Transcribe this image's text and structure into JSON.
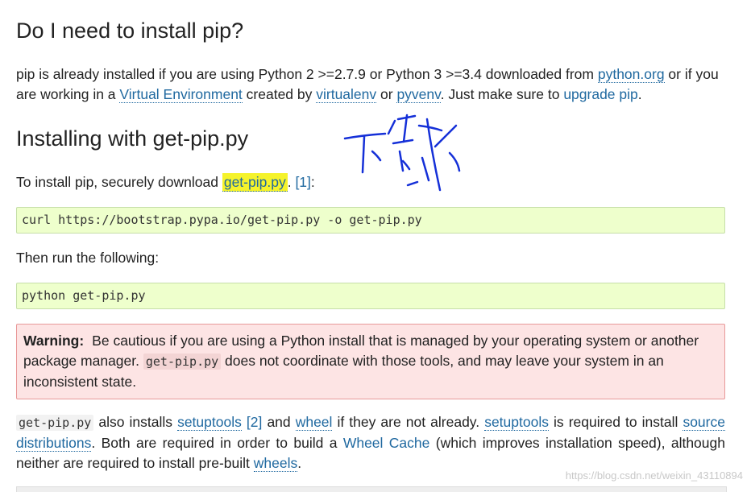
{
  "section_install": {
    "heading": "Do I need to install pip?",
    "text_1": "pip is already installed if you are using Python 2 >=2.7.9 or Python 3 >=3.4 downloaded from ",
    "link_python_org": "python.org",
    "text_2": " or if you are working in a ",
    "link_virtual_env": "Virtual Environment",
    "text_3": " created by ",
    "link_virtualenv": "virtualenv",
    "text_4": " or ",
    "link_pyvenv": "pyvenv",
    "text_5": ". Just make sure to ",
    "link_upgrade_pip": "upgrade pip",
    "text_6": "."
  },
  "section_get_pip": {
    "heading": "Installing with get-pip.py",
    "text_1": "To install pip, securely download ",
    "link_get_pip": "get-pip.py",
    "text_2": ". ",
    "link_footnote": "[1]",
    "text_3": ":",
    "code_curl": "curl https://bootstrap.pypa.io/get-pip.py -o get-pip.py",
    "then_text": "Then run the following:",
    "code_python": "python get-pip.py"
  },
  "warning": {
    "label": "Warning:",
    "text_1": "Be cautious if you are using a Python install that is managed by your operating system or another package manager. ",
    "code": "get-pip.py",
    "text_2": " does not coordinate with those tools, and may leave your system in an inconsistent state."
  },
  "setup_para": {
    "code": "get-pip.py",
    "text_1": " also installs ",
    "link_setuptools": "setuptools",
    "text_sp1": " ",
    "link_footnote2": "[2]",
    "text_2": " and ",
    "link_wheel": "wheel",
    "text_3": " if they are not already. ",
    "link_setuptools2": "setuptools",
    "text_4": " is required to install ",
    "link_source_dist": "source distributions",
    "text_5": ". Both are required in order to build a ",
    "link_wheel_cache": "Wheel Cache",
    "text_6": " (which improves installation speed), although neither are required to install pre-built ",
    "link_wheels": "wheels",
    "text_7": "."
  },
  "watermark": "https://blog.csdn.net/weixin_43110894",
  "colors": {
    "link": "#2069a0",
    "highlight": "#f5f32b",
    "code_bg": "#eeffcc",
    "warning_bg": "#fde4e4",
    "annotation_ink": "#1530d8"
  }
}
